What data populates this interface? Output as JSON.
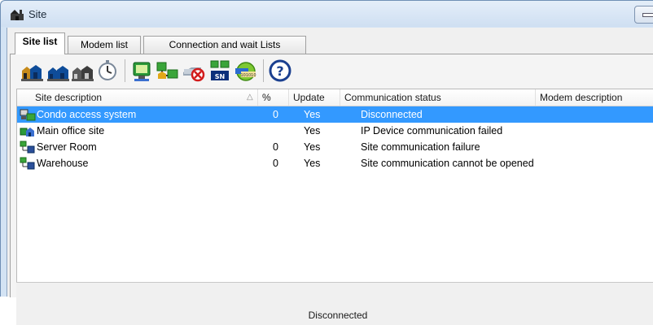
{
  "window": {
    "title": "Site"
  },
  "tabs": [
    {
      "label": "Site list",
      "active": true
    },
    {
      "label": "Modem list",
      "active": false
    },
    {
      "label": "Connection and wait Lists",
      "active": false
    }
  ],
  "toolbar": [
    "add-site-icon",
    "edit-site-icon",
    "delete-site-icon",
    "timer-icon",
    "network-icon",
    "connect-site-icon",
    "disconnect-site-icon",
    "serial-number-icon",
    "transfer-data-icon",
    "help-icon"
  ],
  "grid": {
    "columns": [
      "Site description",
      "%",
      "Update",
      "Communication status",
      "Modem description"
    ],
    "sort_indicator": "△",
    "rows": [
      {
        "description": "Condo access system",
        "percent": "0",
        "update": "Yes",
        "status": "Disconnected",
        "selected": true
      },
      {
        "description": "Main office site",
        "percent": "",
        "update": "Yes",
        "status": "IP Device communication failed",
        "selected": false
      },
      {
        "description": "Server Room",
        "percent": "0",
        "update": "Yes",
        "status": "Site communication failure",
        "selected": false
      },
      {
        "description": "Warehouse",
        "percent": "0",
        "update": "Yes",
        "status": "Site communication cannot be opened",
        "selected": false
      }
    ]
  },
  "status_bar": {
    "text": "Disconnected"
  },
  "colors": {
    "selection": "#3399ff",
    "frame": "#d3e3f4"
  }
}
